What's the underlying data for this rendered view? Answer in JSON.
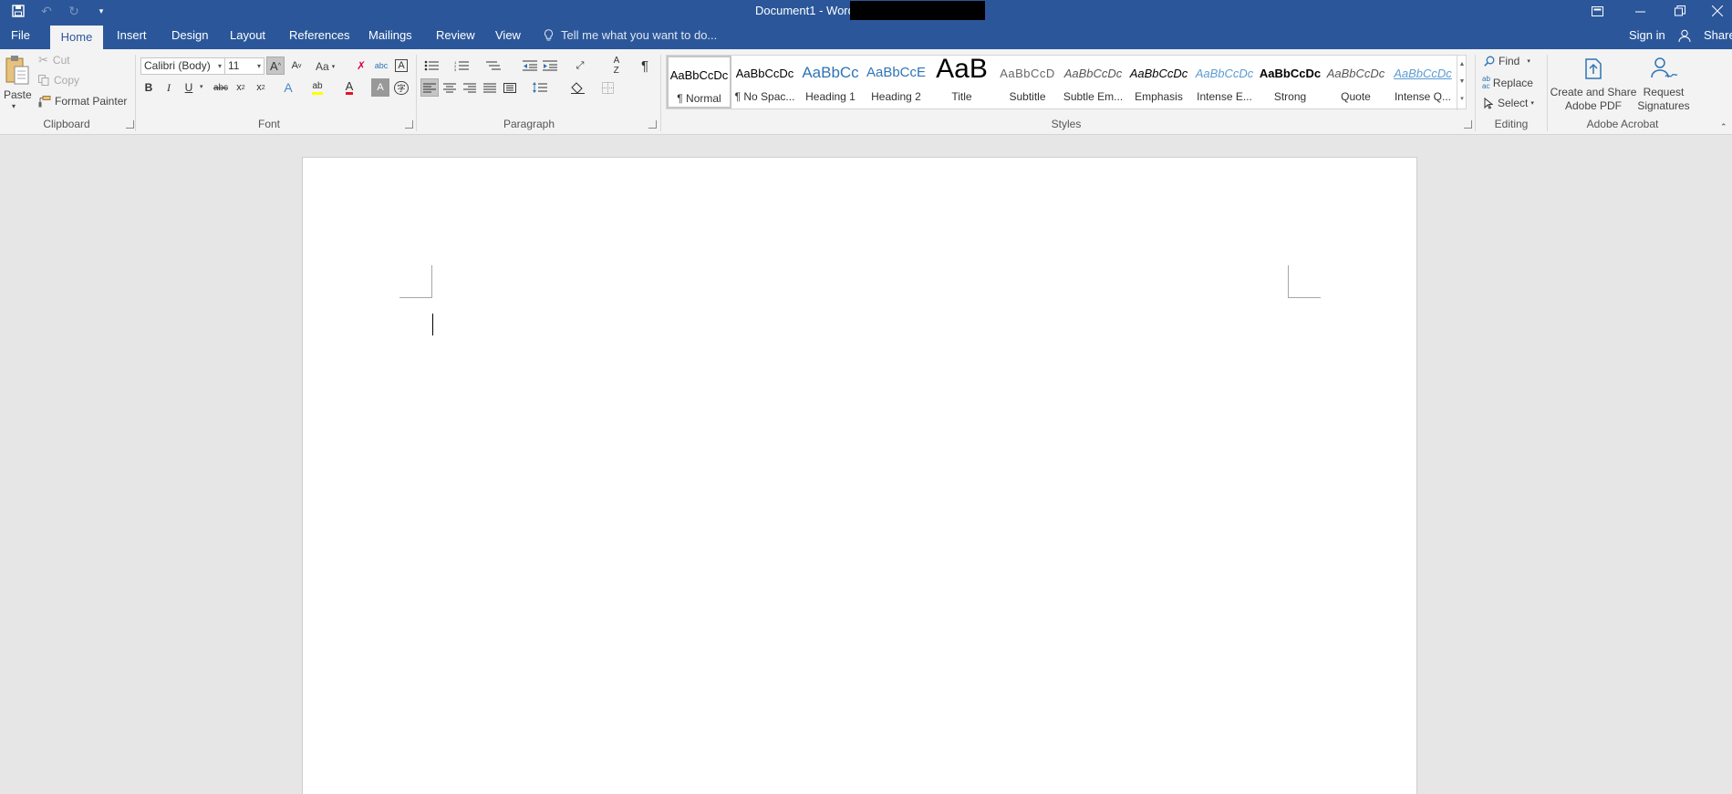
{
  "titlebar": {
    "title": "Document1 - Word",
    "icons": [
      "save-icon",
      "undo-icon",
      "redo-icon",
      "customize-qat-icon",
      "ribbon-display-options-icon",
      "minimize-icon",
      "restore-icon",
      "close-icon"
    ]
  },
  "tabs": {
    "file": "File",
    "home": "Home",
    "insert": "Insert",
    "design": "Design",
    "layout": "Layout",
    "references": "References",
    "mailings": "Mailings",
    "review": "Review",
    "view": "View",
    "tell_me": "Tell me what you want to do...",
    "sign_in": "Sign in",
    "share": "Share"
  },
  "clipboard": {
    "paste": "Paste",
    "cut": "Cut",
    "copy": "Copy",
    "format_painter": "Format Painter",
    "label": "Clipboard"
  },
  "font": {
    "font_name": "Calibri (Body)",
    "font_size": "11",
    "change_case": "Aa",
    "label": "Font"
  },
  "paragraph": {
    "label": "Paragraph"
  },
  "styles": {
    "label": "Styles",
    "items": [
      {
        "preview": "AaBbCcDc",
        "label": "¶ Normal"
      },
      {
        "preview": "AaBbCcDc",
        "label": "¶ No Spac..."
      },
      {
        "preview": "AaBbCc",
        "label": "Heading 1"
      },
      {
        "preview": "AaBbCcE",
        "label": "Heading 2"
      },
      {
        "preview": "AaB",
        "label": "Title"
      },
      {
        "preview": "AaBbCcD",
        "label": "Subtitle"
      },
      {
        "preview": "AaBbCcDc",
        "label": "Subtle Em..."
      },
      {
        "preview": "AaBbCcDc",
        "label": "Emphasis"
      },
      {
        "preview": "AaBbCcDc",
        "label": "Intense E..."
      },
      {
        "preview": "AaBbCcDc",
        "label": "Strong"
      },
      {
        "preview": "AaBbCcDc",
        "label": "Quote"
      },
      {
        "preview": "AaBbCcDc",
        "label": "Intense Q..."
      }
    ]
  },
  "editing": {
    "find": "Find",
    "replace": "Replace",
    "select": "Select",
    "label": "Editing"
  },
  "acrobat": {
    "create_share_line1": "Create and Share",
    "create_share_line2": "Adobe PDF",
    "request_line1": "Request",
    "request_line2": "Signatures",
    "label": "Adobe Acrobat"
  },
  "colors": {
    "brand": "#2b579a",
    "ribbon": "#f3f3f3",
    "canvas": "#e6e6e6",
    "heading_blue": "#2e74b5",
    "font_color_red": "#e81123",
    "highlight_yellow": "#ffff00"
  }
}
